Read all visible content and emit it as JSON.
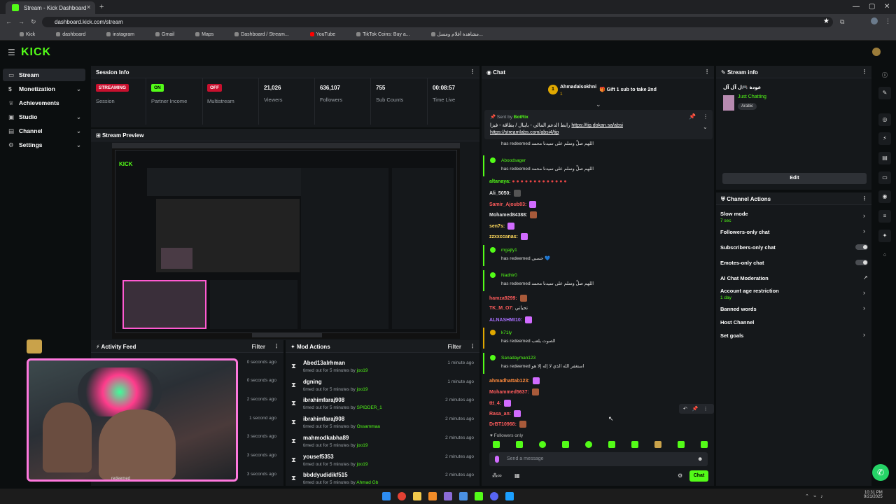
{
  "browser": {
    "tab_title": "Stream - Kick Dashboard",
    "url": "dashboard.kick.com/stream",
    "bookmarks": [
      "Kick",
      "dashboard",
      "instagram",
      "Gmail",
      "Maps",
      "Dashboard / Stream...",
      "YouTube",
      "TikTok Coins: Buy a...",
      "مشاهدة أفلام ومسل..."
    ]
  },
  "sidebar": {
    "items": [
      {
        "label": "Stream",
        "icon": "stream-icon"
      },
      {
        "label": "Monetization",
        "icon": "dollar-icon"
      },
      {
        "label": "Achievements",
        "icon": "trophy-icon"
      },
      {
        "label": "Studio",
        "icon": "studio-icon"
      },
      {
        "label": "Channel",
        "icon": "channel-icon"
      },
      {
        "label": "Settings",
        "icon": "gear-icon"
      }
    ]
  },
  "session": {
    "title": "Session Info",
    "stats": [
      {
        "value": "STREAMING",
        "label": "Session"
      },
      {
        "value": "ON",
        "label": "Partner Income"
      },
      {
        "value": "OFF",
        "label": "Multistream"
      },
      {
        "value": "21,026",
        "label": "Viewers"
      },
      {
        "value": "636,107",
        "label": "Followers"
      },
      {
        "value": "755",
        "label": "Sub Counts"
      },
      {
        "value": "00:08:57",
        "label": "Time Live"
      }
    ]
  },
  "preview": {
    "title": "Stream Preview"
  },
  "activity": {
    "title": "Activity Feed",
    "filter": "Filter",
    "times": [
      "0 seconds ago",
      "0 seconds ago",
      "2 seconds ago",
      "1 second ago",
      "3 seconds ago",
      "3 seconds ago",
      "3 seconds ago"
    ],
    "overlay_text": "redeemed"
  },
  "mod": {
    "title": "Mod Actions",
    "filter": "Filter",
    "rows": [
      {
        "user": "Abed13alrhman",
        "action": "timed out for 5 minutes by",
        "by": "joo19",
        "time": "1 minute ago"
      },
      {
        "user": "dgning",
        "action": "timed out for 5 minutes by",
        "by": "joo19",
        "time": "1 minute ago"
      },
      {
        "user": "ibrahimfaraj908",
        "action": "timed out for 5 minutes by",
        "by": "SPIDDER_1",
        "time": "2 minutes ago"
      },
      {
        "user": "ibrahimfaraj908",
        "action": "timed out for 5 minutes by",
        "by": "Ossammaa",
        "time": "2 minutes ago"
      },
      {
        "user": "mahmodkabha89",
        "action": "timed out for 5 minutes by",
        "by": "joo19",
        "time": "2 minutes ago"
      },
      {
        "user": "yousef5353",
        "action": "timed out for 5 minutes by",
        "by": "joo19",
        "time": "2 minutes ago"
      },
      {
        "user": "bbddyudidikf515",
        "action": "timed out for 5 minutes by",
        "by": "Ahmad Gb",
        "time": "2 minutes ago"
      }
    ]
  },
  "chat": {
    "title": "Chat",
    "gift_user": "Ahmadalsokhni",
    "gift_count": "1",
    "gift_text": "Gift 1 sub to take 2nd",
    "pinned_by": "Sent by",
    "pinned_user": "BotRix",
    "pinned_text": "رابط الدعم المالي - بايبال / بطاقة - فيزا",
    "pinned_link1": "https://tip.dokan.sa/absi",
    "pinned_link2": "https://streamlabs.com/absi4/tip",
    "redeemed": "has redeemed",
    "redeem_text": "اللهم صلِّ وسلم على سيدنا محمد",
    "redeems": [
      {
        "user": "Aboodsager",
        "text": "اللهم صلِّ وسلم على سيدنا محمد"
      },
      {
        "user": "mgajty1",
        "text": "حسبي 💙"
      },
      {
        "user": "Nadhir0",
        "text": "اللهم صلِّ وسلم على سيدنا محمد"
      },
      {
        "user": "k71ly",
        "text": "الصوت يلعب"
      },
      {
        "user": "Sanadayman123",
        "text": "استغفر الله الذي لا إله إلا هو"
      }
    ],
    "messages": [
      {
        "user": "altanaya:",
        "color": "#53fc18"
      },
      {
        "user": "Ali_5050:",
        "color": "#e3e3e3"
      },
      {
        "user": "Samir_Ajoub83:",
        "color": "#ff5c5c"
      },
      {
        "user": "Mohamed84388:",
        "color": "#e3e3e3"
      },
      {
        "user": "sen7s:",
        "color": "#ffd95c"
      },
      {
        "user": "zzxxccanas:",
        "color": "#ffd95c"
      },
      {
        "user": "hamza9299:",
        "color": "#ff5c5c"
      },
      {
        "user": "TK_M_O7:",
        "color": "#ff5c5c",
        "text": "تحياتي"
      },
      {
        "user": "ALNASHMI10:",
        "color": "#a970ff"
      },
      {
        "user": "ahmadhattab123:",
        "color": "#ff8a3c"
      },
      {
        "user": "Mohammed5637:",
        "color": "#ff5c5c"
      },
      {
        "user": "ttt_4:",
        "color": "#ff5c5c"
      },
      {
        "user": "Rasa_an:",
        "color": "#ff5c5c"
      },
      {
        "user": "DrBT10968:",
        "color": "#ff5c5c"
      }
    ],
    "followers_only": "Followers only",
    "placeholder": "Send a message",
    "send_label": "Chat"
  },
  "stream_info": {
    "title": "Stream info",
    "stream_title": "عودة 🎮ل آل آل",
    "category": "Just Chatting",
    "tag": "Arabic",
    "edit_label": "Edit"
  },
  "channel_actions": {
    "title": "Channel Actions",
    "rows": [
      {
        "label": "Slow mode",
        "sub": "7 sec",
        "control": "chevron"
      },
      {
        "label": "Followers-only chat",
        "sub": "",
        "control": "chevron"
      },
      {
        "label": "Subscribers-only chat",
        "sub": "",
        "control": "toggle"
      },
      {
        "label": "Emotes-only chat",
        "sub": "",
        "control": "toggle"
      },
      {
        "label": "AI Chat Moderation",
        "sub": "",
        "control": "external"
      },
      {
        "label": "Account age restriction",
        "sub": "1 day",
        "control": "chevron"
      },
      {
        "label": "Banned words",
        "sub": "",
        "control": "chevron"
      },
      {
        "label": "Host Channel",
        "sub": "",
        "control": "none"
      },
      {
        "label": "Set goals",
        "sub": "",
        "control": "chevron"
      }
    ]
  },
  "taskbar": {
    "time": "10:31 PM",
    "date": "9/21/2025"
  },
  "colors": {
    "brand": "#53fc18",
    "live_red": "#c8102e",
    "panel": "#15181b",
    "bg": "#0b0e0f"
  }
}
